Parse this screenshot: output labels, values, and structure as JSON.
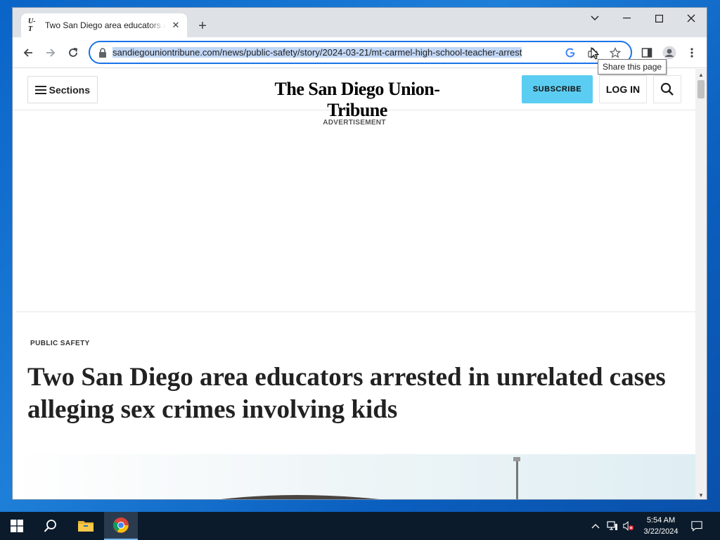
{
  "browser": {
    "tab": {
      "favicon_text": "U-T",
      "title": "Two San Diego area educators arrested in unrelated cases alleging sex crimes involving kids",
      "close_glyph": "✕"
    },
    "new_tab_glyph": "+",
    "window_controls": {
      "tab_search": "⌄",
      "minimize": "—",
      "maximize": "☐",
      "close": "✕"
    },
    "url": "sandiegouniontribune.com/news/public-safety/story/2024-03-21/mt-carmel-high-school-teacher-arrest",
    "tooltip": "Share this page",
    "icons": {
      "back": "arrow-left-icon",
      "forward": "arrow-right-icon",
      "reload": "reload-icon",
      "lock": "lock-icon",
      "google": "google-icon",
      "share": "share-icon",
      "bookmark": "star-icon",
      "side_panel": "side-panel-icon",
      "profile": "profile-icon",
      "menu": "kebab-menu-icon"
    }
  },
  "site": {
    "sections_label": "Sections",
    "masthead": "The San Diego Union-Tribune",
    "subscribe_label": "SUBSCRIBE",
    "login_label": "LOG IN",
    "advertisement_label": "ADVERTISEMENT",
    "kicker": "PUBLIC SAFETY",
    "headline": "Two San Diego area educators arrested in unrelated cases alleging sex crimes involving kids"
  },
  "taskbar": {
    "time": "5:54 AM",
    "date": "3/22/2024"
  },
  "colors": {
    "accent": "#1a73e8",
    "subscribe": "#5bcdf2",
    "taskbar": "#0c1b2c"
  }
}
